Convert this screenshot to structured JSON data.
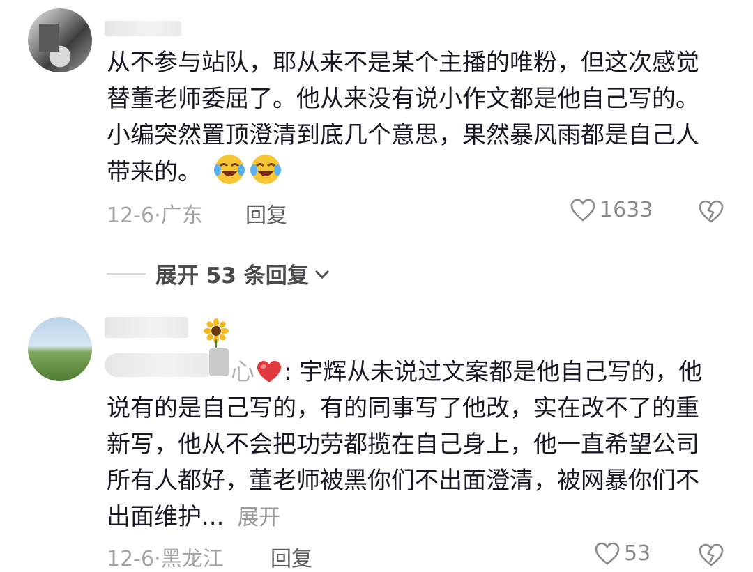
{
  "comments": [
    {
      "text": "从不参与站队，耶从来不是某个主播的唯粉，但这次感觉替董老师委屈了。他从来没有说小作文都是他自己写的。小编突然置顶澄清到底几个意思，果然暴风雨都是自己人带来的。",
      "date": "12-6",
      "region": "广东",
      "reply_label": "回复",
      "likes": "1633",
      "emoji_count": 2
    },
    {
      "name_suffix": "心",
      "text": ": 宇辉从未说过文案都是他自己写的，他说有的是自己写的，有的同事写了他改，实在改不了的重新写，他从不会把功劳都揽在自己身上，他一直希望公司所有人都好，董老师被黑你们不出面澄清，被网暴你们不出面维护...",
      "more_label": "展开",
      "date": "12-6",
      "region": "黑龙江",
      "reply_label": "回复",
      "likes": "53"
    }
  ],
  "expand_replies": {
    "label": "展开 53 条回复"
  },
  "colors": {
    "text": "#161823",
    "meta": "#a3a3a3",
    "heart": "#e0393e"
  },
  "icons": [
    "heart-outline-icon",
    "broken-heart-icon",
    "chevron-down-icon",
    "laughing-emoji-icon",
    "sunflower-icon"
  ]
}
